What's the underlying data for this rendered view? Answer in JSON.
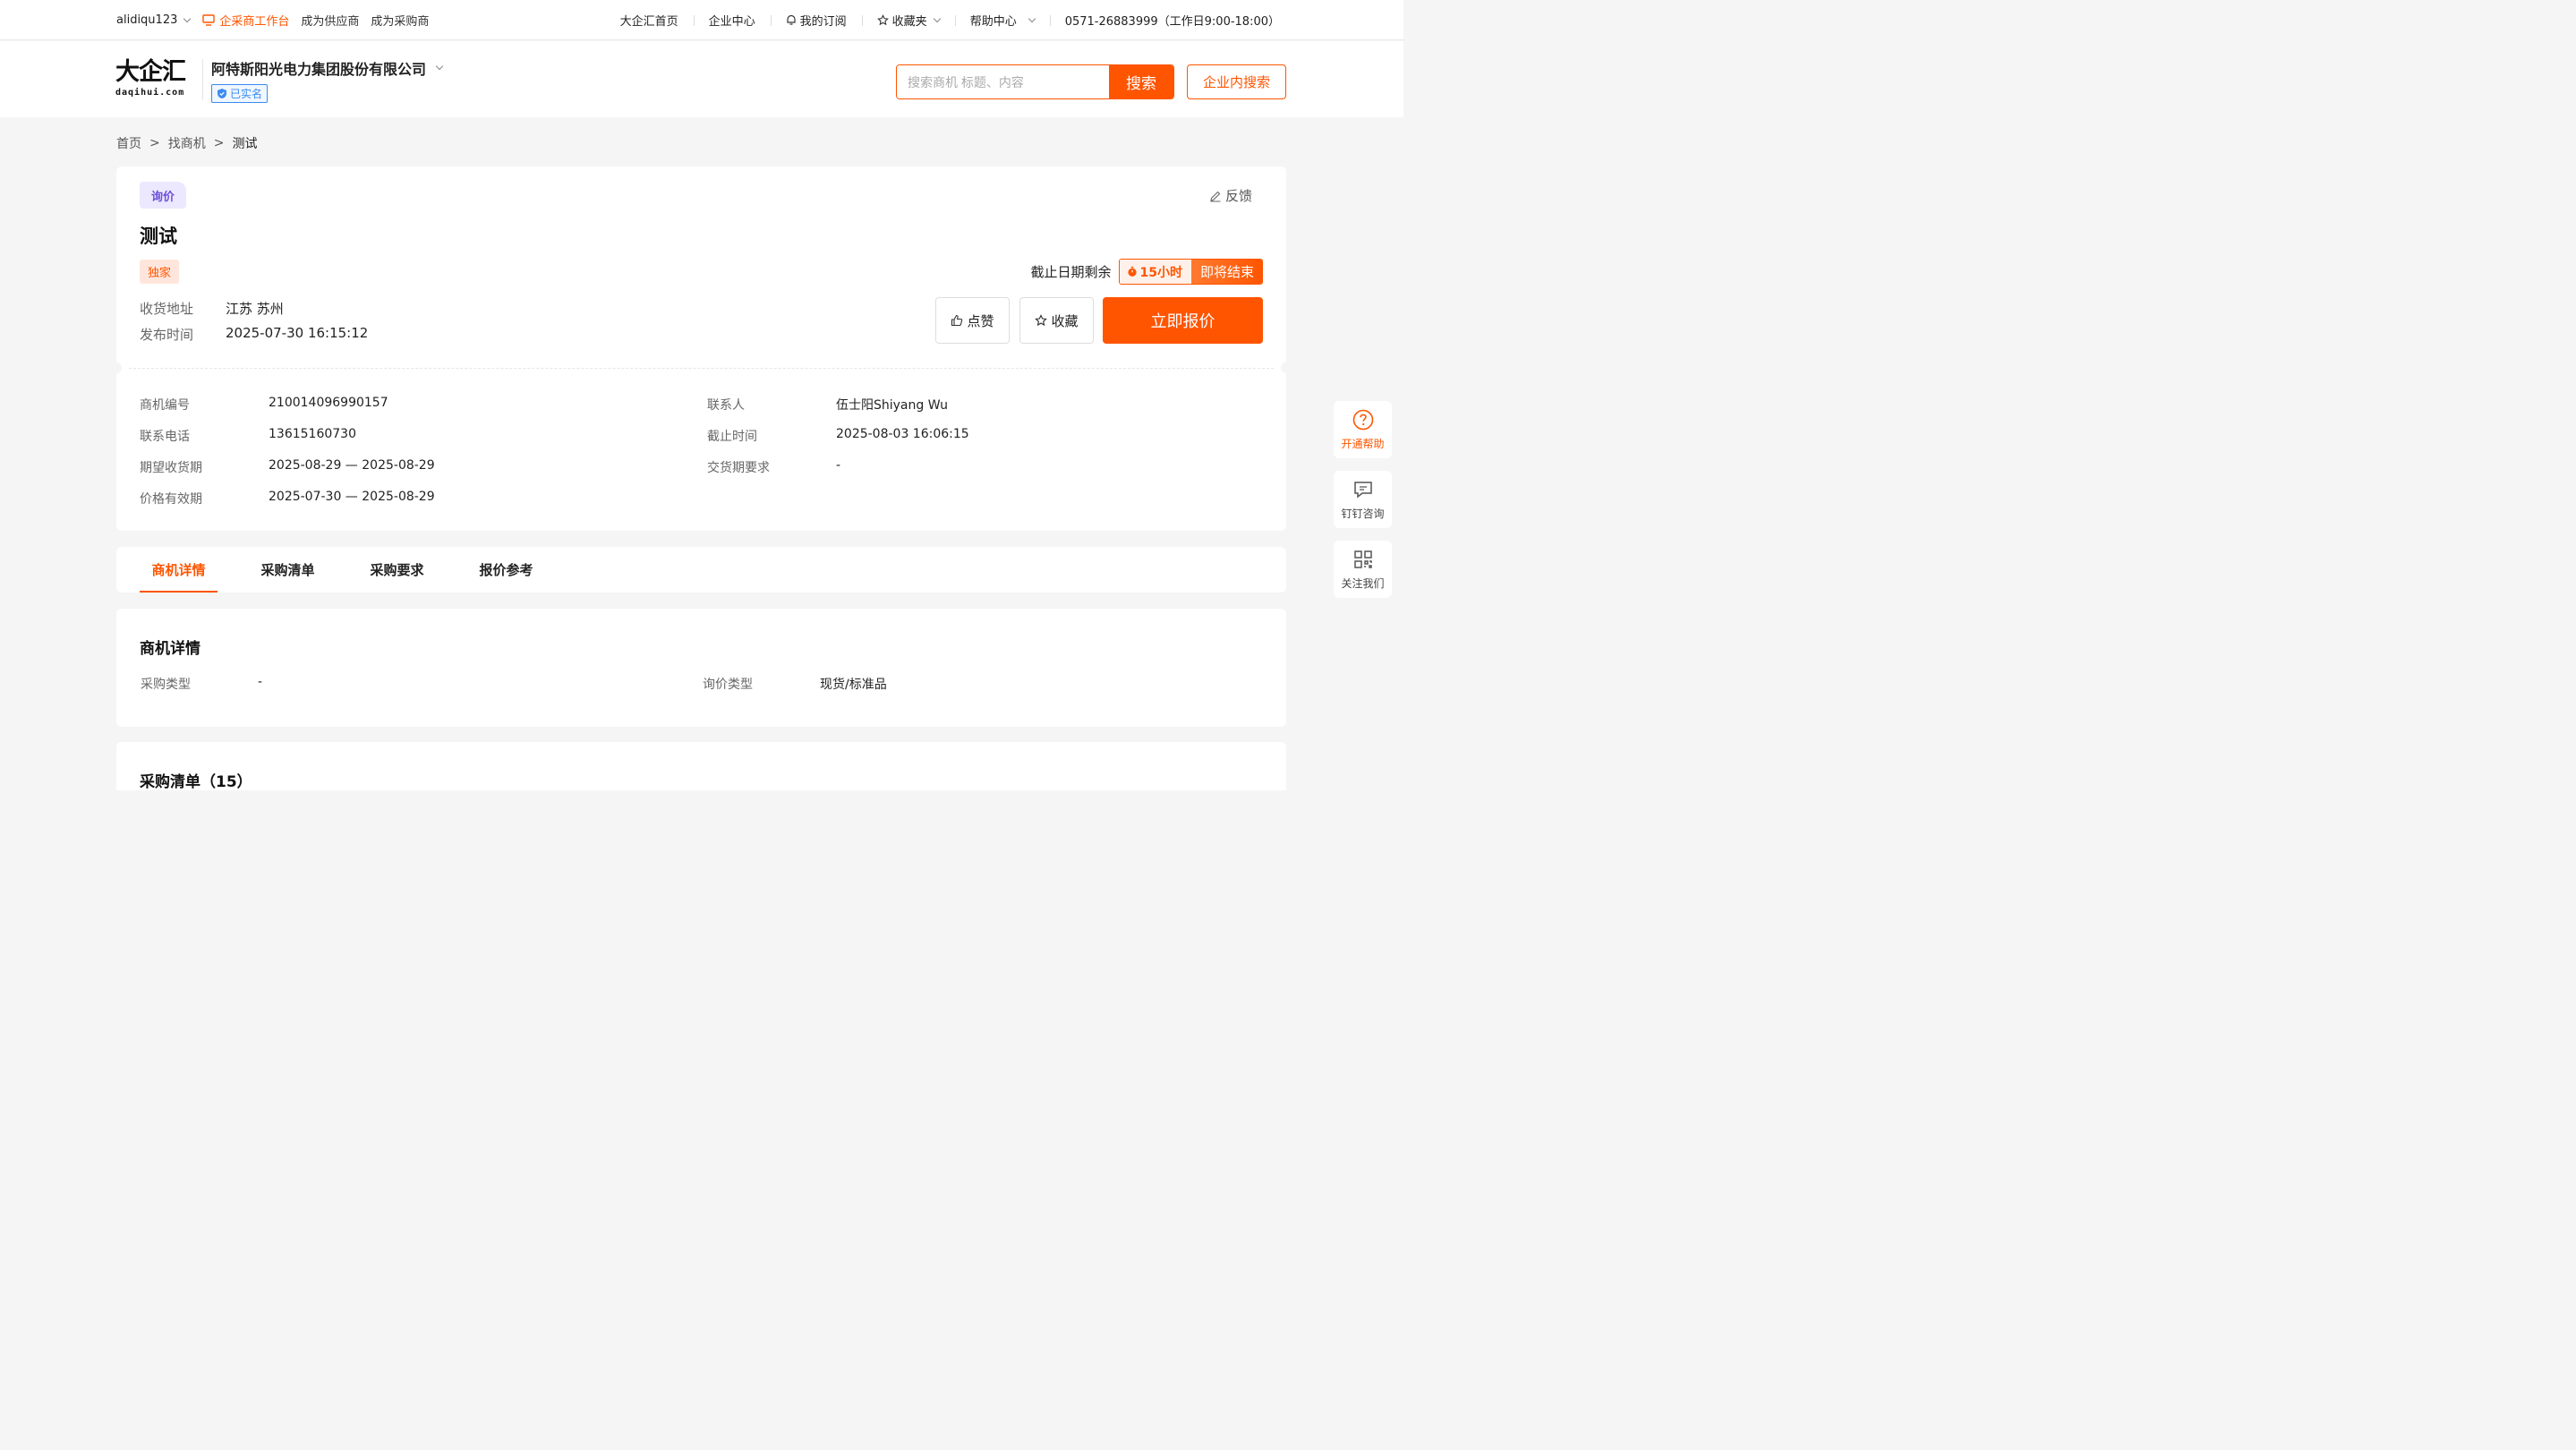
{
  "topbar": {
    "username": "alidiqu123",
    "workbench": "企采商工作台",
    "become_supplier": "成为供应商",
    "become_buyer": "成为采购商",
    "nav": {
      "home": "大企汇首页",
      "enterprise_center": "企业中心",
      "subscription": "我的订阅",
      "favorites": "收藏夹",
      "help": "帮助中心",
      "phone": "0571-26883999（工作日9:00-18:00）"
    }
  },
  "header": {
    "logo_text": "大企汇",
    "logo_sub": "daqihui.com",
    "company_name": "阿特斯阳光电力集团股份有限公司",
    "verified": "已实名",
    "search_placeholder": "搜索商机 标题、内容",
    "search_button": "搜索",
    "inner_search": "企业内搜索"
  },
  "breadcrumb": {
    "home": "首页",
    "sep": ">",
    "level2": "找商机",
    "current": "测试"
  },
  "opportunity": {
    "tag": "询价",
    "feedback": "反馈",
    "title": "测试",
    "exclusive": "独家",
    "address_label": "收货地址",
    "address": "江苏 苏州",
    "publish_label": "发布时间",
    "publish_time": "2025-07-30 16:15:12",
    "deadline_label": "截止日期剩余",
    "countdown_hours": "15小时",
    "countdown_status": "即将结束",
    "like": "点赞",
    "favorite": "收藏",
    "quote_now": "立即报价"
  },
  "details": {
    "left": [
      {
        "label": "商机编号",
        "value": "210014096990157"
      },
      {
        "label": "联系电话",
        "value": "13615160730"
      },
      {
        "label": "期望收货期",
        "value": "2025-08-29 — 2025-08-29"
      },
      {
        "label": "价格有效期",
        "value": "2025-07-30 — 2025-08-29"
      }
    ],
    "right": [
      {
        "label": "联系人",
        "value": "伍士阳Shiyang Wu"
      },
      {
        "label": "截止时间",
        "value": "2025-08-03 16:06:15"
      },
      {
        "label": "交货期要求",
        "value": "-"
      }
    ]
  },
  "tabs": [
    "商机详情",
    "采购清单",
    "采购要求",
    "报价参考"
  ],
  "section_detail": {
    "title": "商机详情",
    "purchase_type_label": "采购类型",
    "purchase_type": "-",
    "inquiry_type_label": "询价类型",
    "inquiry_type": "现货/标准品"
  },
  "section_list": {
    "title": "采购清单（15）"
  },
  "side": {
    "help": "开通帮助",
    "dingtalk": "钉钉咨询",
    "follow": "关注我们"
  },
  "colors": {
    "accent": "#ff5500",
    "verified": "#3b8bf0",
    "inquiry_tag": "#6c4fd9"
  }
}
